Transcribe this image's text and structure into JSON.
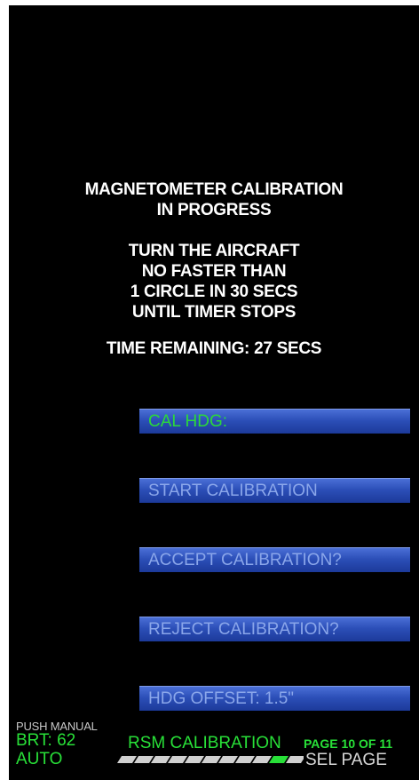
{
  "status": {
    "line1": "MAGNETOMETER CALIBRATION",
    "line2": "IN PROGRESS",
    "instruction1": "TURN THE AIRCRAFT",
    "instruction2": "NO FASTER THAN",
    "instruction3": "1 CIRCLE IN 30 SECS",
    "instruction4": "UNTIL TIMER STOPS",
    "time_remaining": "TIME REMAINING:  27 SECS"
  },
  "buttons": {
    "cal_hdg": "CAL HDG:",
    "start": "START CALIBRATION",
    "accept": "ACCEPT CALIBRATION?",
    "reject": "REJECT CALIBRATION?",
    "hdg_offset": "HDG OFFSET: 1.5\""
  },
  "footer": {
    "push_manual": "PUSH MANUAL",
    "brt": "BRT: 62",
    "auto": "AUTO",
    "page_title": "RSM CALIBRATION",
    "page_indicator": "PAGE 10 OF 11",
    "sel_page": "SEL PAGE",
    "current_page": 10,
    "total_pages": 11
  },
  "colors": {
    "background": "#000000",
    "accent_green": "#28e038",
    "button_blue": "#2c4fb8",
    "button_text": "#8aa6ea"
  }
}
